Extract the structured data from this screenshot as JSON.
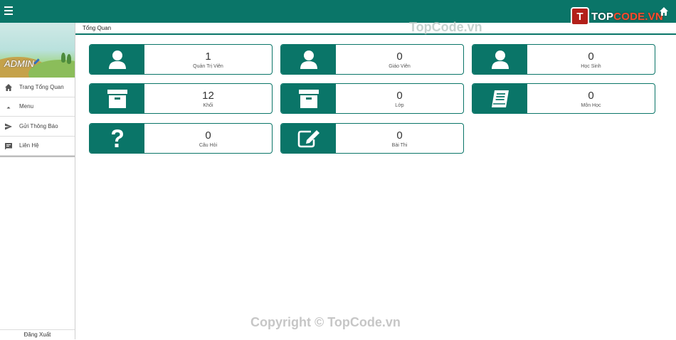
{
  "header": {
    "logo_badge": "T",
    "logo_text_a": "TOP",
    "logo_text_b": "CODE.VN"
  },
  "sidebar": {
    "admin_label": "ADMIN",
    "items": [
      {
        "label": "Trang Tổng Quan",
        "icon": "home-icon"
      },
      {
        "label": "Menu",
        "icon": "caret-up-icon"
      },
      {
        "label": "Gửi Thông Báo",
        "icon": "send-icon"
      },
      {
        "label": "Liên Hệ",
        "icon": "message-icon"
      }
    ],
    "logout_label": "Đăng Xuất"
  },
  "breadcrumb": "Tổng Quan",
  "cards": [
    {
      "value": "1",
      "label": "Quản Trị Viên",
      "icon": "user-icon"
    },
    {
      "value": "0",
      "label": "Giáo Viên",
      "icon": "user-icon"
    },
    {
      "value": "0",
      "label": "Học Sinh",
      "icon": "user-icon"
    },
    {
      "value": "12",
      "label": "Khối",
      "icon": "archive-icon"
    },
    {
      "value": "0",
      "label": "Lớp",
      "icon": "archive-icon"
    },
    {
      "value": "0",
      "label": "Môn Học",
      "icon": "book-icon"
    },
    {
      "value": "0",
      "label": "Câu Hỏi",
      "icon": "question-icon"
    },
    {
      "value": "0",
      "label": "Bài Thi",
      "icon": "edit-icon"
    }
  ],
  "watermark_top": "TopCode.vn",
  "watermark_bottom": "Copyright © TopCode.vn",
  "colors": {
    "primary": "#0a7568"
  }
}
